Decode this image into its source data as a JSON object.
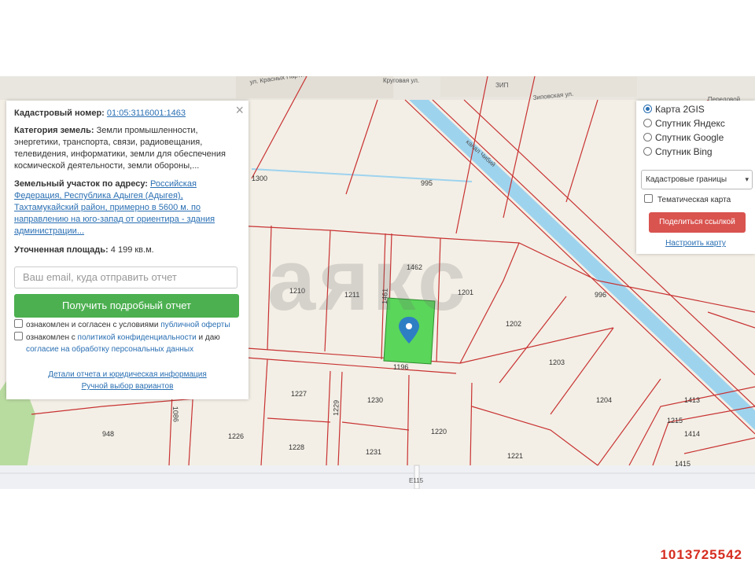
{
  "map": {
    "streets": [
      "ул. Красных Партизан",
      "Круговая ул.",
      "ЗИП",
      "Зиповская ул.",
      "Передовой",
      "канал Чибий",
      "E115"
    ],
    "plots": [
      "1300",
      "995",
      "1462",
      "1210",
      "1211",
      "1461",
      "1201",
      "996",
      "1202",
      "1203",
      "1204",
      "1196",
      "1227",
      "1230",
      "1229",
      "1086",
      "1226",
      "1228",
      "1231",
      "1220",
      "1221",
      "1413",
      "1215",
      "1414",
      "1415",
      "948"
    ],
    "watermark": "аякс",
    "selected_color": "#5ad65a",
    "boundary_color": "#c83232"
  },
  "info": {
    "cadastral_label": "Кадастровый номер:",
    "cadastral_number": "01:05:3116001:1463",
    "category_label": "Категория земель:",
    "category_text": "Земли промышленности, энергетики, транспорта, связи, радиовещания, телевидения, информатики, земли для обеспечения космической деятельности, земли обороны,...",
    "address_label": "Земельный участок по адресу:",
    "address_text": "Российская Федерация, Республика Адыгея (Адыгея), Тахтамукайский район, примерно в 5600 м. по направлению на юго-запад от ориентира - здания администрации...",
    "area_label": "Уточненная площадь:",
    "area_value": "4 199 кв.м.",
    "email_placeholder": "Ваш email, куда отправить отчет",
    "report_button": "Получить подробный отчет",
    "consent1_text": "ознакомлен и согласен с условиями",
    "consent1_link": "публичной оферты",
    "consent2_text": "ознакомлен с",
    "consent2_link": "политикой конфиденциальности",
    "consent2_and": "и даю",
    "consent2_link2": "согласие на обработку персональных данных",
    "details_link": "Детали отчета и юридическая информация",
    "manual_link": "Ручной выбор вариантов",
    "close_icon": "close-icon"
  },
  "layers": {
    "options": [
      {
        "label": "Карта 2GIS",
        "selected": true
      },
      {
        "label": "Спутник Яндекс",
        "selected": false
      },
      {
        "label": "Спутник Google",
        "selected": false
      },
      {
        "label": "Спутник Bing",
        "selected": false
      }
    ],
    "boundaries_select": "Кадастровые границы",
    "thematic_label": "Тематическая карта",
    "share_button": "Поделиться ссылкой",
    "setup_link": "Настроить карту"
  },
  "listing_id": "1013725542"
}
